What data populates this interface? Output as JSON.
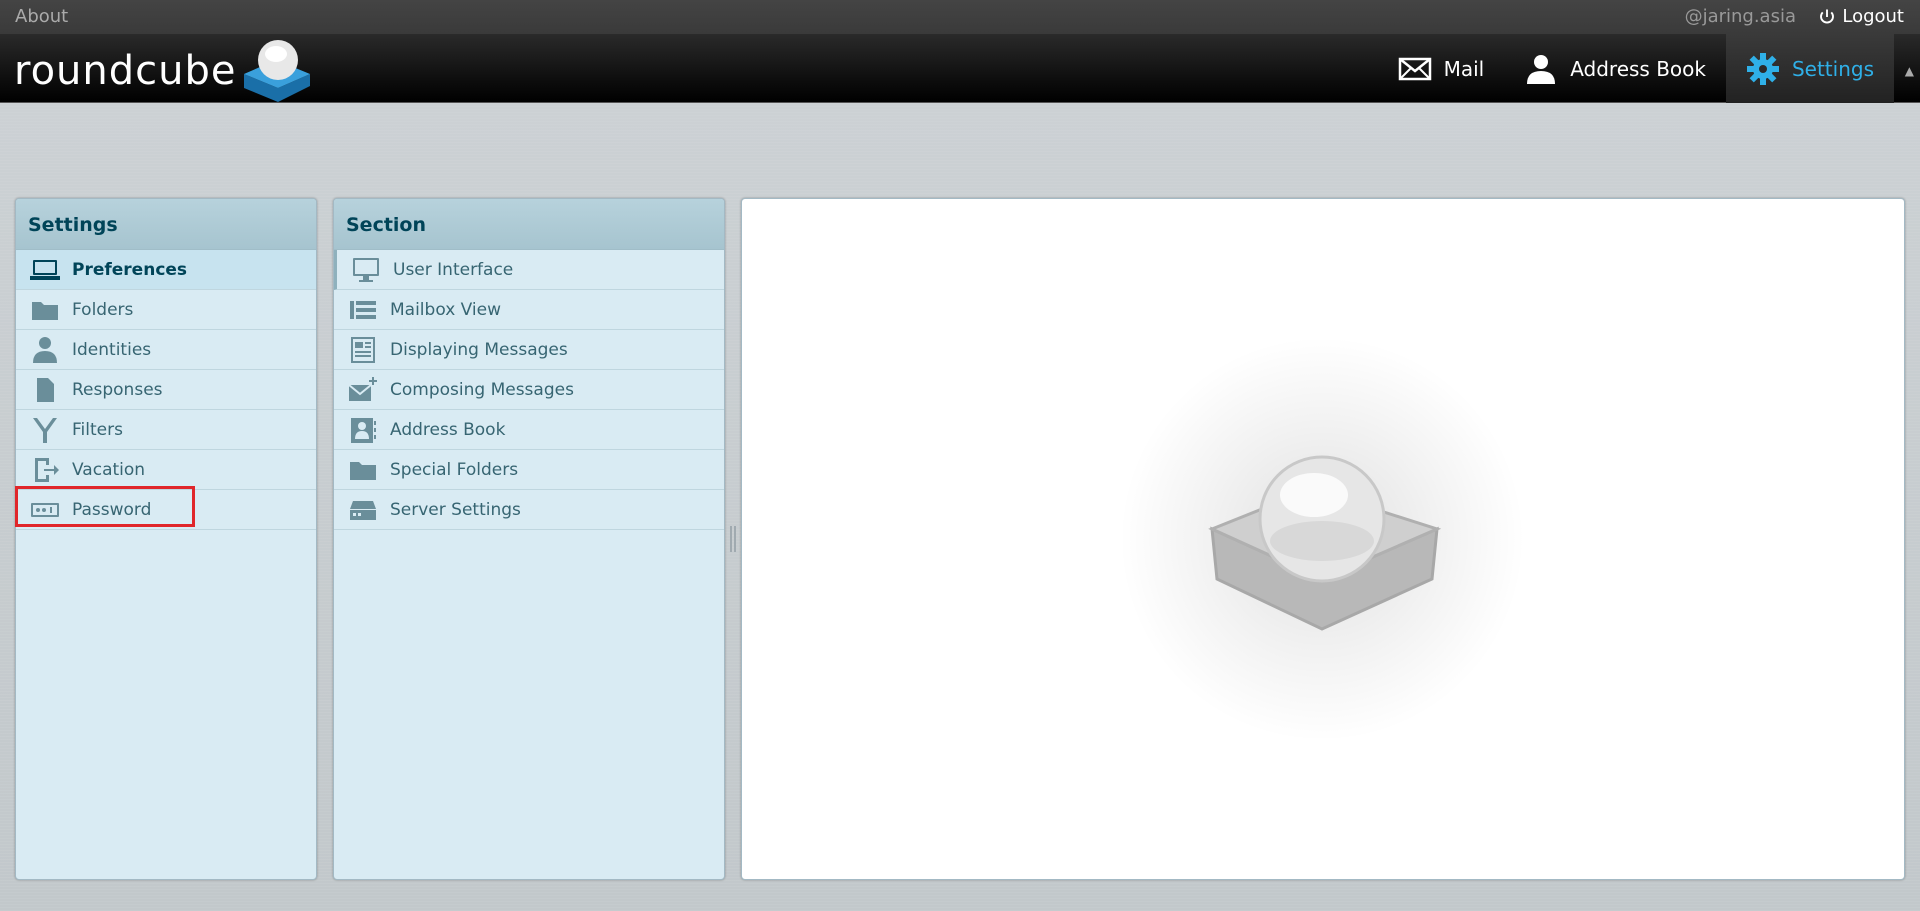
{
  "topline": {
    "about": "About",
    "user": "@jaring.asia",
    "logout": "Logout"
  },
  "logo": {
    "text": "roundcube"
  },
  "nav": {
    "mail": "Mail",
    "address_book": "Address Book",
    "settings": "Settings"
  },
  "settings_panel": {
    "title": "Settings",
    "items": [
      {
        "label": "Preferences",
        "icon": "monitor-icon",
        "selected": true
      },
      {
        "label": "Folders",
        "icon": "folder-icon"
      },
      {
        "label": "Identities",
        "icon": "person-icon"
      },
      {
        "label": "Responses",
        "icon": "document-icon"
      },
      {
        "label": "Filters",
        "icon": "filter-icon"
      },
      {
        "label": "Vacation",
        "icon": "exit-icon"
      },
      {
        "label": "Password",
        "icon": "password-icon"
      }
    ]
  },
  "section_panel": {
    "title": "Section",
    "items": [
      {
        "label": "User Interface",
        "icon": "monitor-icon"
      },
      {
        "label": "Mailbox View",
        "icon": "list-icon"
      },
      {
        "label": "Displaying Messages",
        "icon": "message-icon"
      },
      {
        "label": "Composing Messages",
        "icon": "compose-icon"
      },
      {
        "label": "Address Book",
        "icon": "contact-card-icon"
      },
      {
        "label": "Special Folders",
        "icon": "folder-icon"
      },
      {
        "label": "Server Settings",
        "icon": "server-icon"
      }
    ]
  },
  "colors": {
    "accent": "#2fb0e8",
    "panel_bg": "#d9ebf3",
    "highlight": "#e0262a"
  }
}
